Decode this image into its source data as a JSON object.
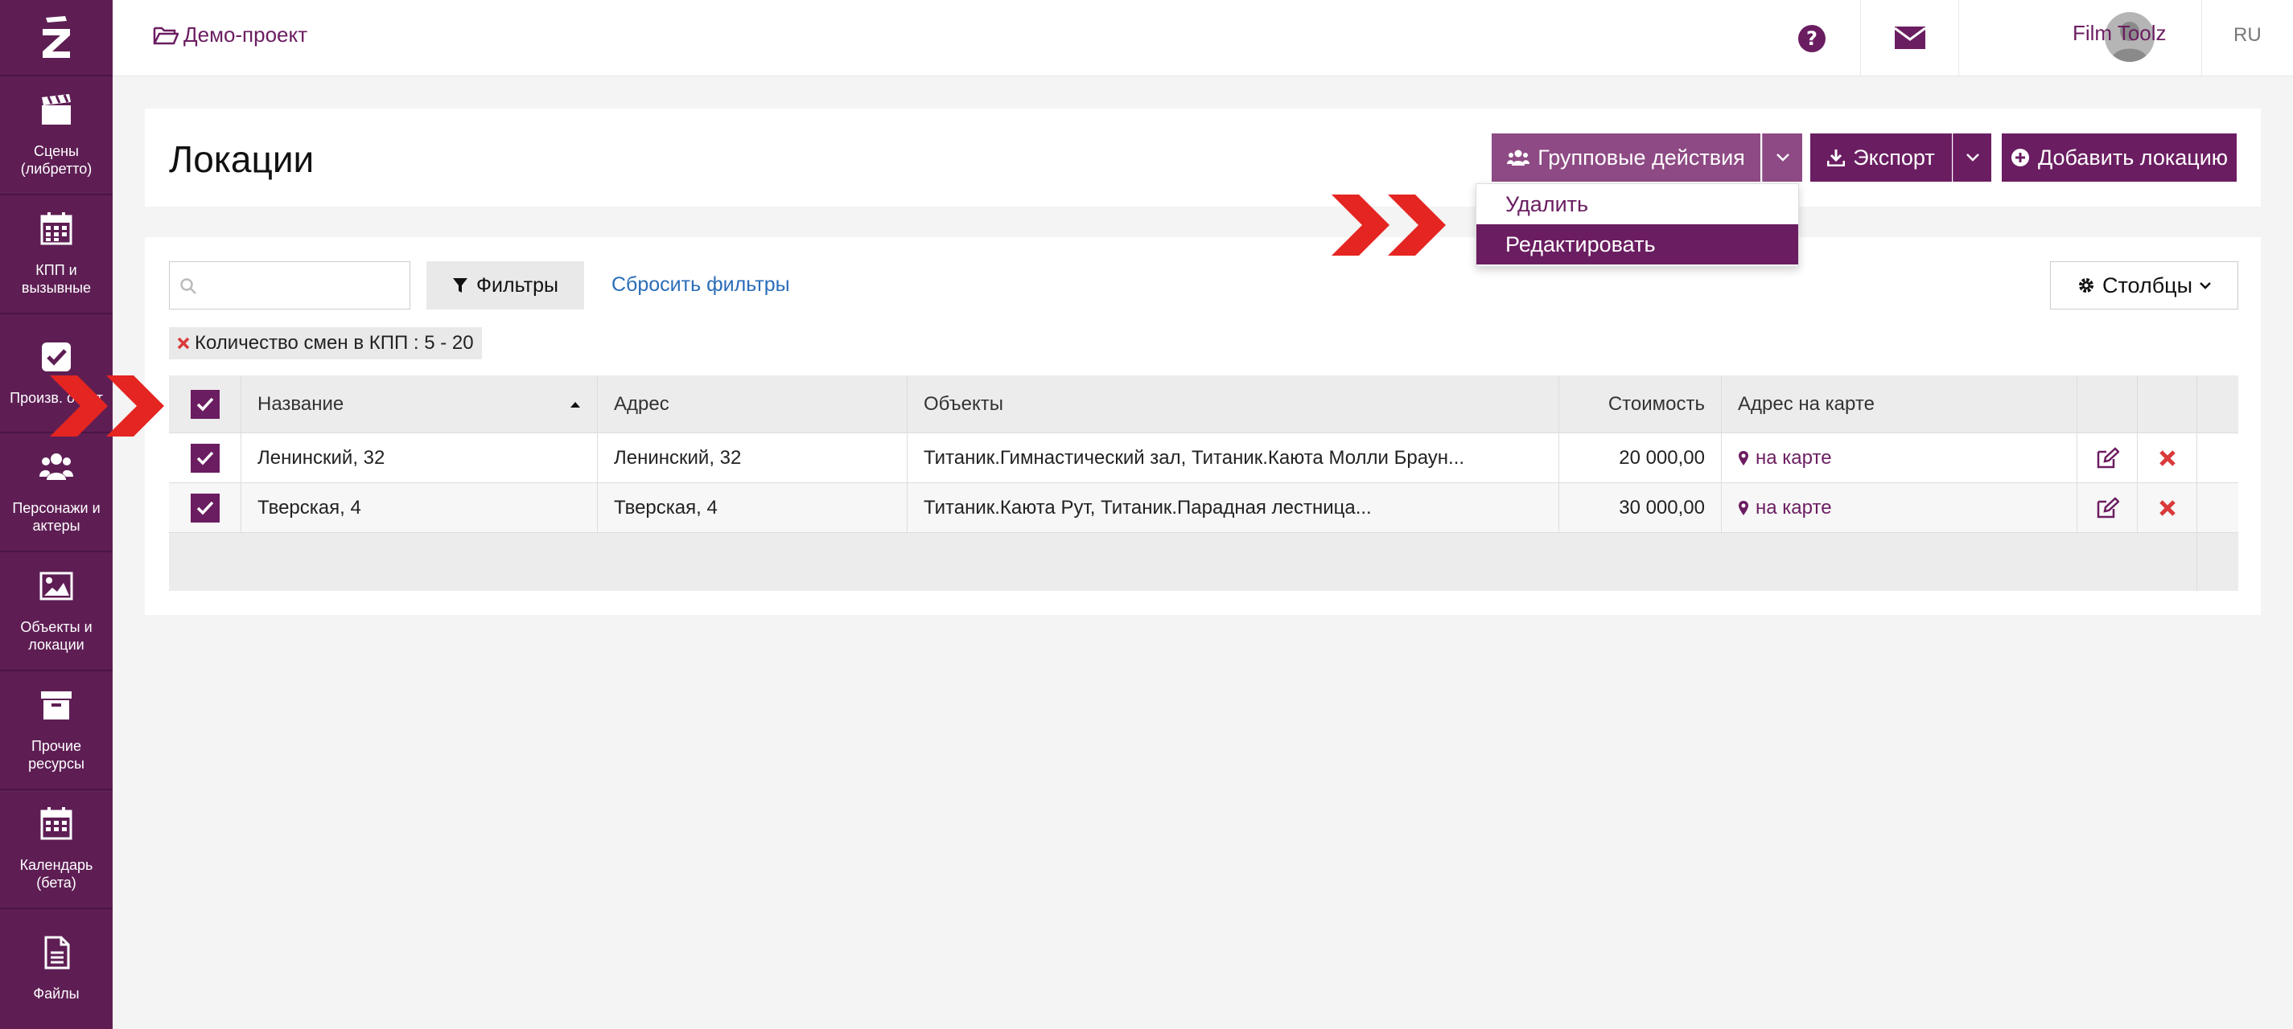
{
  "breadcrumb": {
    "label": "Демо-проект"
  },
  "user": {
    "name": "Film Toolz"
  },
  "language": "RU",
  "sidebar": {
    "items": [
      {
        "label": "Сцены (либретто)",
        "icon": "clapperboard-icon"
      },
      {
        "label": "КПП и вызывные",
        "icon": "calendar-grid-icon"
      },
      {
        "label": "Произв. отчет",
        "icon": "checkbox-icon"
      },
      {
        "label": "Персонажи и актеры",
        "icon": "users-icon"
      },
      {
        "label": "Объекты и локации",
        "icon": "image-icon"
      },
      {
        "label": "Прочие ресурсы",
        "icon": "archive-icon"
      },
      {
        "label": "Календарь (бета)",
        "icon": "calendar-icon"
      },
      {
        "label": "Файлы",
        "icon": "file-icon"
      }
    ]
  },
  "header": {
    "title": "Локации",
    "group_actions_label": "Групповые действия",
    "export_label": "Экспорт",
    "add_label": "Добавить локацию"
  },
  "dropdown": {
    "items": [
      {
        "label": "Удалить"
      },
      {
        "label": "Редактировать"
      }
    ]
  },
  "toolbar": {
    "search_placeholder": "",
    "filters_label": "Фильтры",
    "reset_label": "Сбросить фильтры",
    "columns_label": "Столбцы",
    "active_filter": "Количество смен в КПП :  5 - 20"
  },
  "table": {
    "columns": [
      "Название",
      "Адрес",
      "Объекты",
      "Стоимость",
      "Адрес на карте"
    ],
    "rows": [
      {
        "name": "Ленинский, 32",
        "address": "Ленинский, 32",
        "objects": "Титаник.Гимнастический зал, Титаник.Каюта Молли Браун...",
        "cost": "20 000,00",
        "map": "на карте",
        "checked": true
      },
      {
        "name": "Тверская, 4",
        "address": "Тверская, 4",
        "objects": "Титаник.Каюта Рут, Титаник.Парадная лестница...",
        "cost": "30 000,00",
        "map": "на карте",
        "checked": true
      }
    ]
  },
  "colors": {
    "brand": "#6b1d61",
    "sidebar": "#5e1e54",
    "annotation_arrow": "#e52521",
    "delete_red": "#d93a3a",
    "link_blue": "#2a6db8"
  }
}
